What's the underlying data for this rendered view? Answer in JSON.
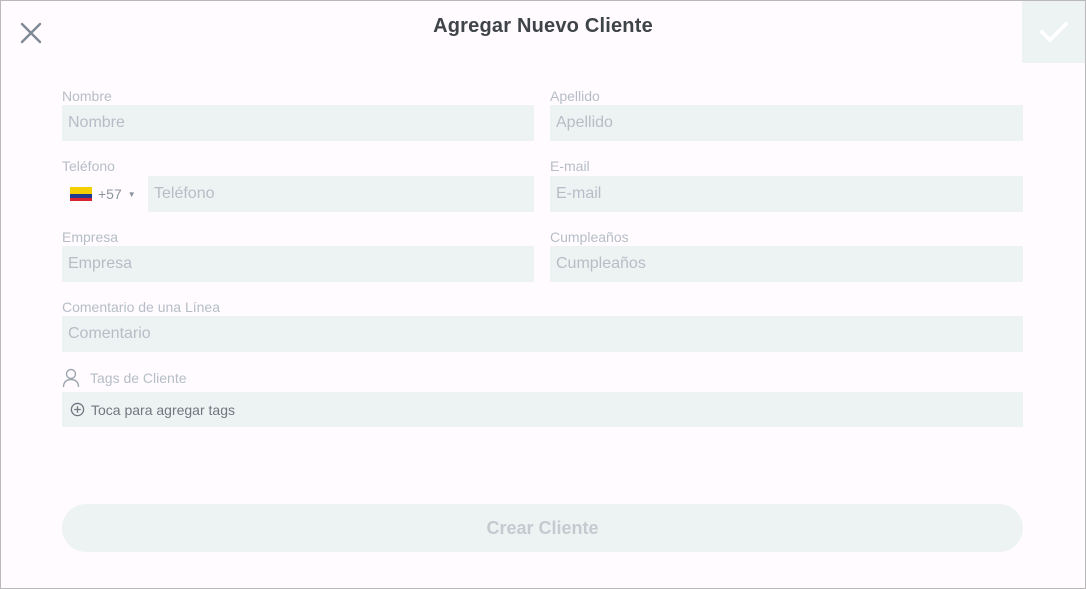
{
  "header": {
    "title": "Agregar Nuevo Cliente",
    "close_icon": "close-icon",
    "confirm_icon": "check-icon"
  },
  "form": {
    "first_name": {
      "label": "Nombre",
      "placeholder": "Nombre",
      "value": ""
    },
    "last_name": {
      "label": "Apellido",
      "placeholder": "Apellido",
      "value": ""
    },
    "phone": {
      "label": "Teléfono",
      "placeholder": "Teléfono",
      "value": "",
      "country_code": "+57",
      "country_flag": "colombia-flag-icon"
    },
    "email": {
      "label": "E-mail",
      "placeholder": "E-mail",
      "value": ""
    },
    "company": {
      "label": "Empresa",
      "placeholder": "Empresa",
      "value": ""
    },
    "birthday": {
      "label": "Cumpleaños",
      "placeholder": "Cumpleaños",
      "value": ""
    },
    "comment": {
      "label": "Comentario de una Línea",
      "placeholder": "Comentario",
      "value": ""
    },
    "tags": {
      "label": "Tags de Cliente",
      "add_text": "Toca para agregar tags",
      "icon": "person-icon",
      "add_icon": "plus-circle-icon"
    }
  },
  "actions": {
    "create_label": "Crear Cliente"
  },
  "colors": {
    "background": "#fffbff",
    "field_bg": "#edf3f3",
    "label": "#b5bec6",
    "title": "#3f4448",
    "icon": "#7d8a96"
  }
}
